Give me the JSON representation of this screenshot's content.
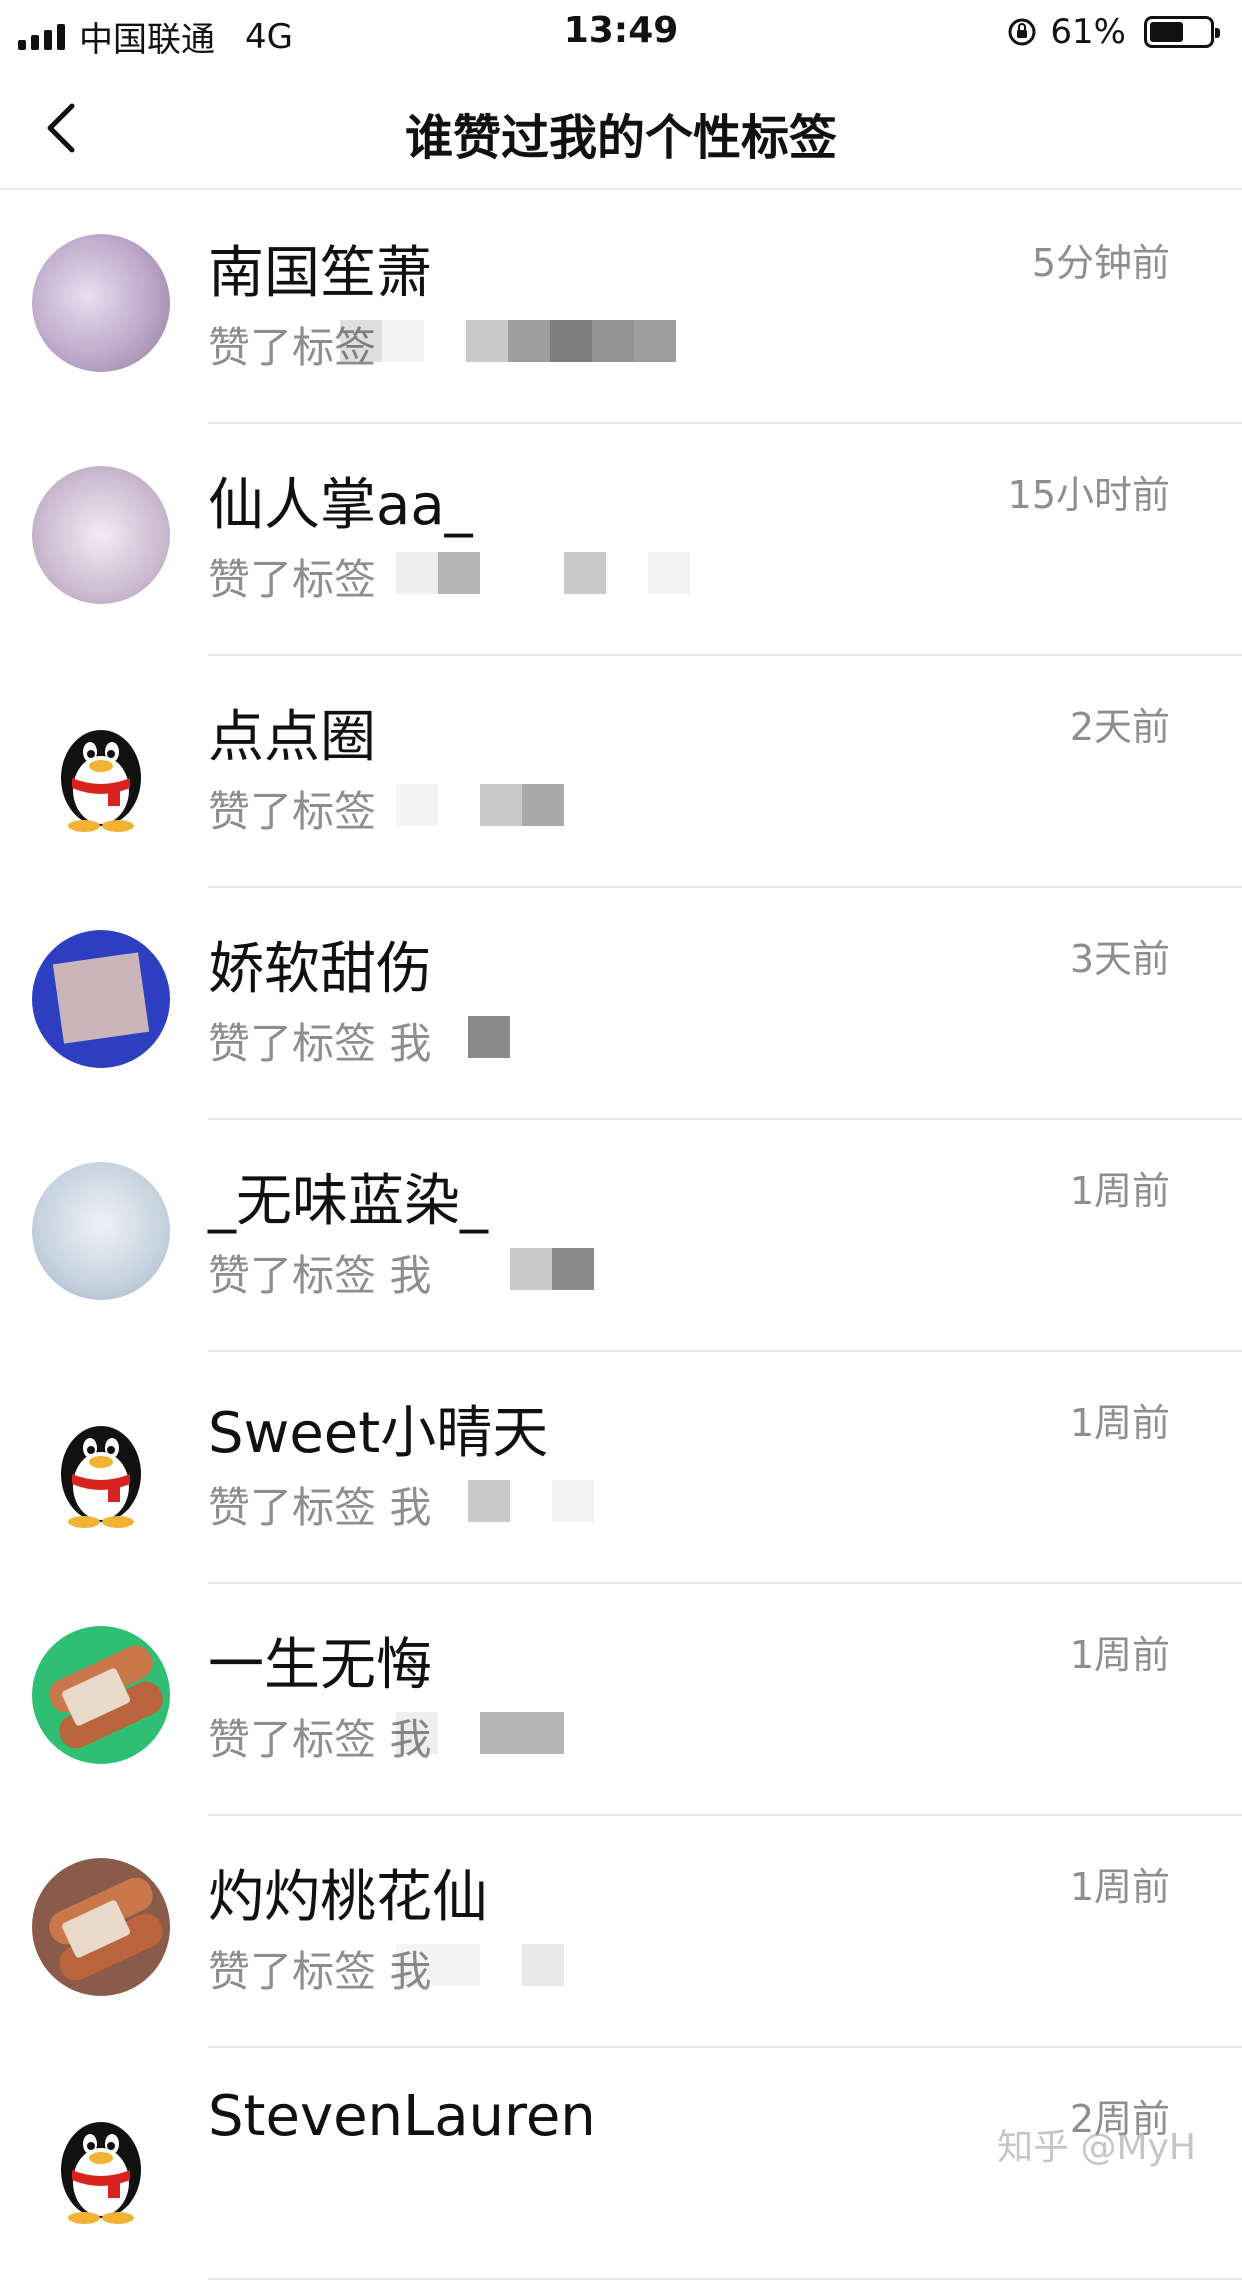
{
  "status_bar": {
    "carrier": "中国联通",
    "network": "4G",
    "time": "13:49",
    "battery": "61%",
    "battery_level": 0.61
  },
  "nav": {
    "back_icon": "chevron-left-icon",
    "title": "谁赞过我的个性标签"
  },
  "list": [
    {
      "name": "南国笙萧",
      "sub": "赞了标签",
      "time": "5分钟前",
      "avatar": "photo1"
    },
    {
      "name": "仙人掌aa_",
      "sub": "赞了标签",
      "time": "15小时前",
      "avatar": "photo2"
    },
    {
      "name": "点点圈",
      "sub": "赞了标签",
      "time": "2天前",
      "avatar": "penguin"
    },
    {
      "name": "娇软甜伤",
      "sub": "赞了标签  我",
      "time": "3天前",
      "avatar": "blue"
    },
    {
      "name": "_无味蓝染_",
      "sub": "赞了标签  我",
      "time": "1周前",
      "avatar": "photo3"
    },
    {
      "name": "Sweet小晴天",
      "sub": "赞了标签  我",
      "time": "1周前",
      "avatar": "penguin"
    },
    {
      "name": "一生无悔",
      "sub": "赞了标签  我",
      "time": "1周前",
      "avatar": "green"
    },
    {
      "name": "灼灼桃花仙",
      "sub": "赞了标签  我",
      "time": "1周前",
      "avatar": "brown"
    },
    {
      "name": "StevenLauren",
      "sub": "",
      "time": "2周前",
      "avatar": "penguin"
    }
  ],
  "watermark": "知乎 @MyH"
}
